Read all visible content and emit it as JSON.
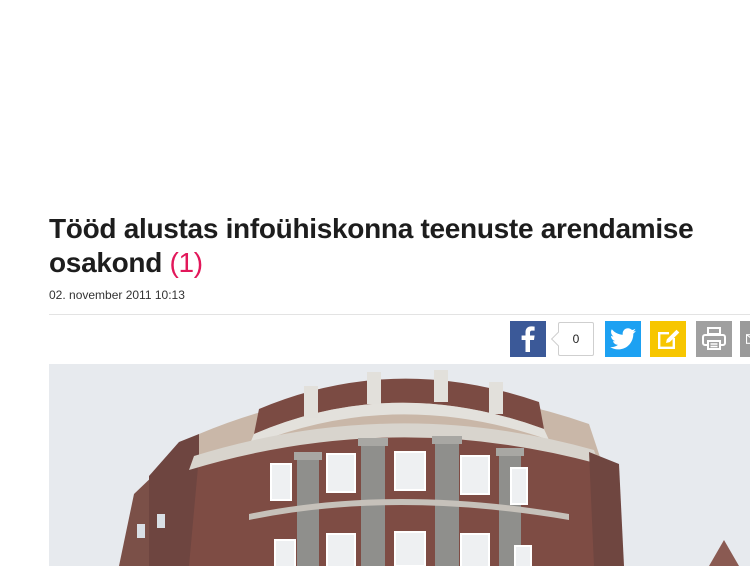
{
  "article": {
    "title": "Tööd alustas infoühiskonna teenuste arendamise osakond",
    "comment_count": "(1)",
    "date": "02. november 2011 10:13"
  },
  "share": {
    "facebook_count": "0",
    "icons": [
      "facebook-icon",
      "twitter-icon",
      "edit-icon",
      "print-icon",
      "mail-icon"
    ]
  },
  "colors": {
    "accent": "#e2175a",
    "facebook": "#3b5998",
    "twitter": "#1da1f2",
    "edit": "#f7c600",
    "print": "#a0a0a0"
  }
}
